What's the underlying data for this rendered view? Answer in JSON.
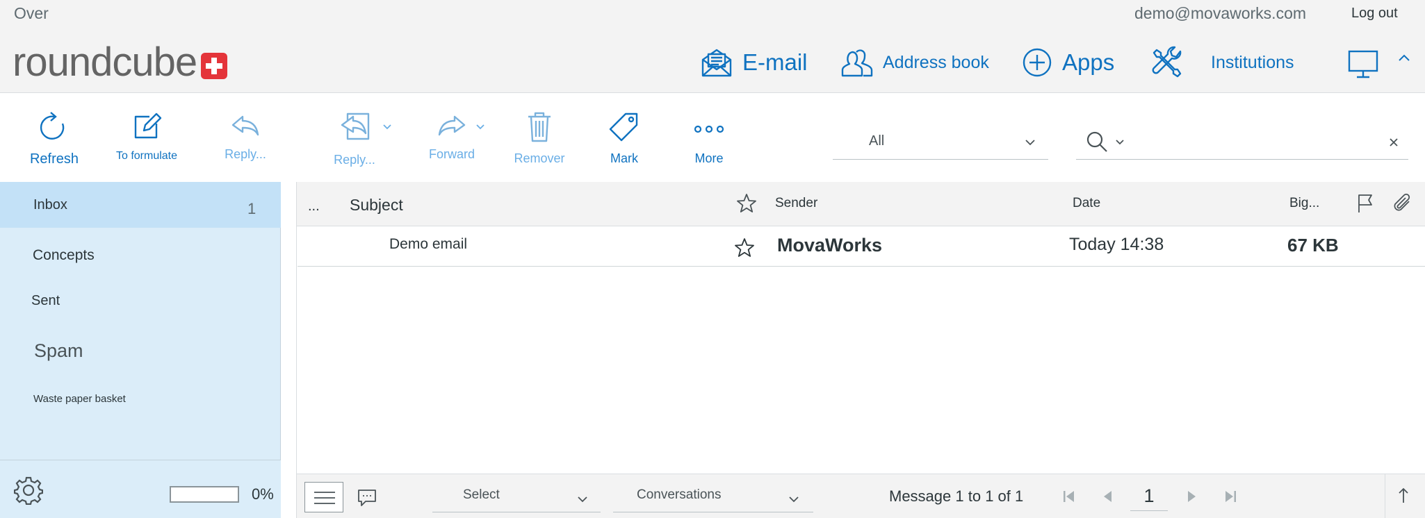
{
  "header": {
    "about_label": "Over",
    "user_email": "demo@movaworks.com",
    "logout_label": "Log out",
    "logo_text": "roundcube",
    "nav": {
      "mail": "E-mail",
      "contacts": "Address book",
      "apps": "Apps",
      "settings": "Institutions"
    }
  },
  "toolbar": {
    "refresh": "Refresh",
    "compose": "To formulate",
    "reply": "Reply...",
    "reply_all": "Reply...",
    "forward": "Forward",
    "delete": "Remover",
    "mark": "Mark",
    "more": "More",
    "filter_value": "All",
    "search_placeholder": ""
  },
  "folders": [
    {
      "name": "Inbox",
      "unread": "1"
    },
    {
      "name": "Concepts"
    },
    {
      "name": "Sent"
    },
    {
      "name": "Spam"
    },
    {
      "name": "Waste paper basket"
    }
  ],
  "quota": {
    "percent_label": "0%",
    "fraction": 0.0
  },
  "message_list": {
    "columns": {
      "threads": "...",
      "subject": "Subject",
      "from": "Sender",
      "date": "Date",
      "size": "Big..."
    },
    "rows": [
      {
        "subject": "Demo email",
        "from": "MovaWorks",
        "date": "Today 14:38",
        "size": "67 KB"
      }
    ]
  },
  "footer": {
    "select_label": "Select",
    "threads_label": "Conversations",
    "count_text": "Message 1 to 1 of 1",
    "page_number": "1"
  },
  "colors": {
    "accent": "#0f72c0",
    "sidebar_bg": "#dbedf9",
    "selected_folder_bg": "#c3e1f7",
    "header_bg": "#f3f3f3",
    "logo_red": "#e4343a"
  }
}
